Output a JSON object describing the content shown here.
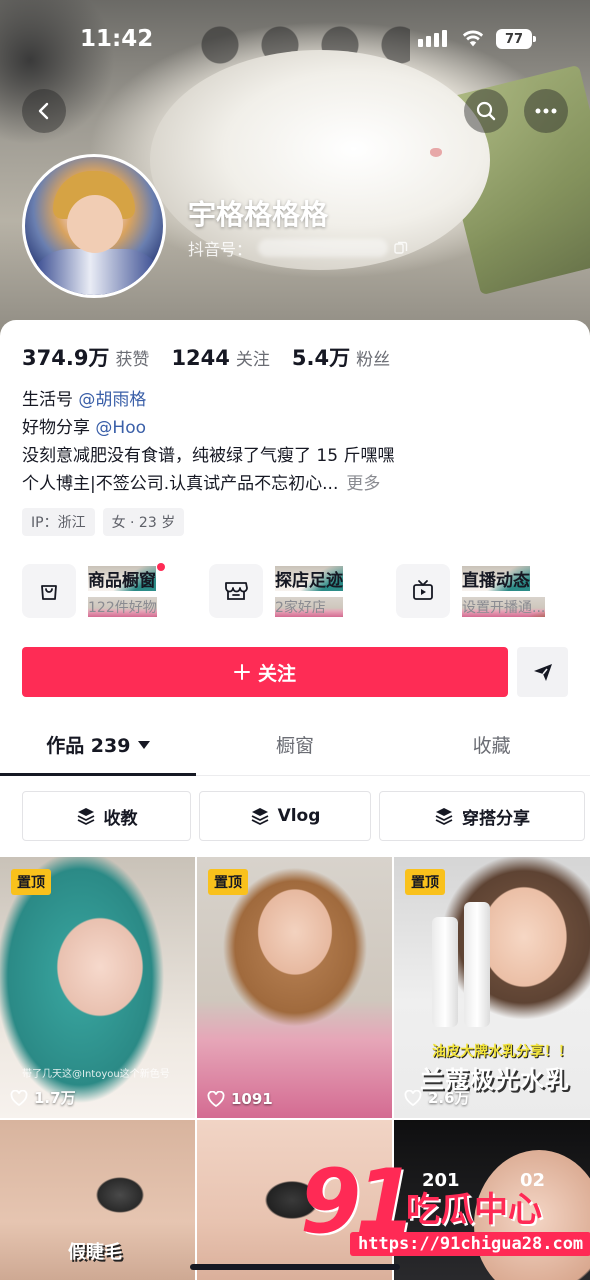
{
  "status_bar": {
    "time": "11:42",
    "battery": "77"
  },
  "profile": {
    "nickname": "宇格格格格",
    "douyin_id_label": "抖音号：",
    "stats": [
      {
        "num": "374.9万",
        "label": "获赞"
      },
      {
        "num": "1244",
        "label": "关注"
      },
      {
        "num": "5.4万",
        "label": "粉丝"
      }
    ],
    "bio": {
      "line1_prefix": "生活号 ",
      "line1_link": "@胡雨格",
      "line2_prefix": "好物分享 ",
      "line2_link": "@Hoo",
      "line3": "没刻意减肥没有食谱，纯被绿了气瘦了 15 斤嘿嘿",
      "line4": "个人博主|不签公司.认真试产品不忘初心...",
      "more": "更多"
    },
    "tags": [
      "IP：浙江",
      "女 · 23 岁"
    ]
  },
  "features": [
    {
      "title": "商品橱窗",
      "sub": "122件好物",
      "icon": "shopping-bag-icon"
    },
    {
      "title": "探店足迹",
      "sub": "2家好店",
      "icon": "store-icon"
    },
    {
      "title": "直播动态",
      "sub": "设置开播通...",
      "icon": "tv-icon"
    }
  ],
  "actions": {
    "follow": "关注"
  },
  "tabs": [
    {
      "label": "作品 239"
    },
    {
      "label": "橱窗"
    },
    {
      "label": "收藏"
    }
  ],
  "collections": [
    "收教",
    "Vlog",
    "穿搭分享"
  ],
  "videos": [
    {
      "pinned": "置顶",
      "likes": "1.7万",
      "small_caption": "带了几天这@Intoyou这个新色号"
    },
    {
      "pinned": "置顶",
      "likes": "1091"
    },
    {
      "pinned": "置顶",
      "likes": "2.6万",
      "caption_top": "油皮大牌水乳分享！！",
      "caption_main": "兰蔻极光水乳"
    },
    {
      "caption": "假睫毛"
    },
    {},
    {}
  ],
  "watermark": {
    "big": "91",
    "cn": "吃瓜中心",
    "url": "https://91chigua28.com",
    "y1": "201",
    "y2": "02"
  },
  "colors": {
    "accent": "#fe2c55",
    "pin": "#f9c11c",
    "link": "#3a5fa8"
  }
}
